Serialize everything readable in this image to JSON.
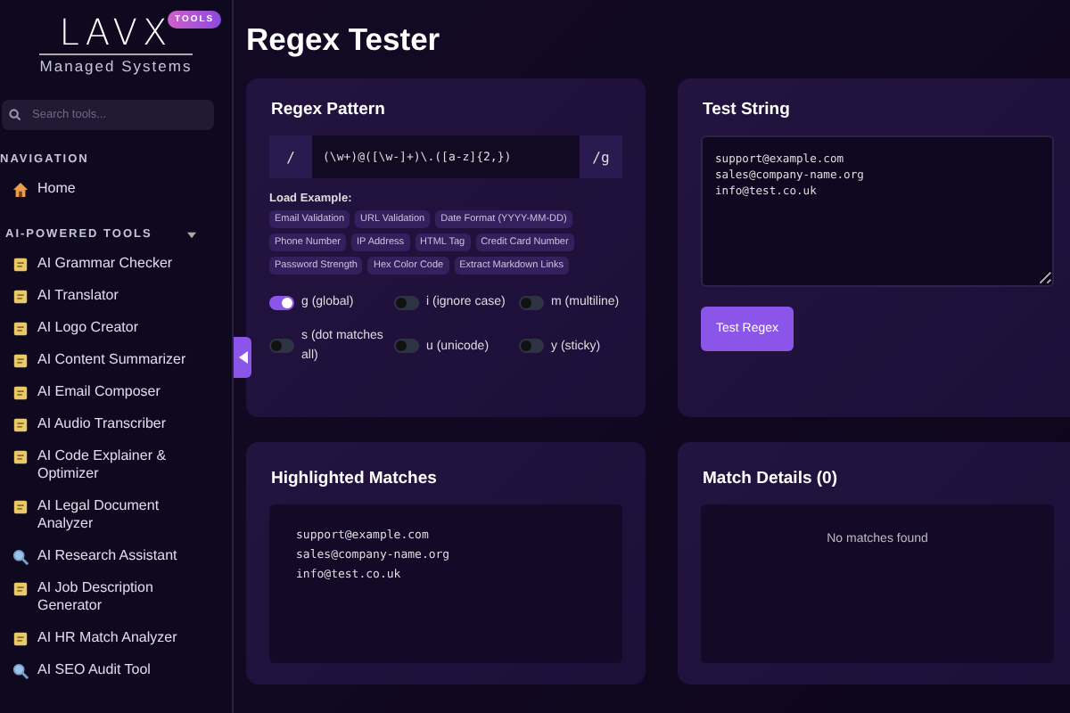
{
  "sidebar": {
    "logo": "LAVX",
    "logo_badge": "TOOLS",
    "tagline": "Managed Systems",
    "search": {
      "placeholder": "Search tools..."
    },
    "sections": [
      {
        "title": "NAVIGATION",
        "items": [
          {
            "label": "Home",
            "kind": "home"
          }
        ]
      },
      {
        "title": "AI-POWERED TOOLS",
        "expanded": true,
        "items": [
          {
            "label": "AI Grammar Checker",
            "kind": "tool"
          },
          {
            "label": "AI Translator",
            "kind": "tool"
          },
          {
            "label": "AI Logo Creator",
            "kind": "tool"
          },
          {
            "label": "AI Content Summarizer",
            "kind": "tool"
          },
          {
            "label": "AI Email Composer",
            "kind": "tool"
          },
          {
            "label": "AI Audio Transcriber",
            "kind": "tool"
          },
          {
            "label": "AI Code Explainer & Optimizer",
            "kind": "tool"
          },
          {
            "label": "AI Legal Document Analyzer",
            "kind": "tool"
          },
          {
            "label": "AI Research Assistant",
            "kind": "search"
          },
          {
            "label": "AI Job Description Generator",
            "kind": "tool"
          },
          {
            "label": "AI HR Match Analyzer",
            "kind": "tool"
          },
          {
            "label": "AI SEO Audit Tool",
            "kind": "search"
          }
        ]
      }
    ]
  },
  "page_title": "Regex Tester",
  "pattern_card": {
    "title": "Regex Pattern",
    "prefix": "/",
    "value": "(\\w+)@([\\w-]+)\\.([a-z]{2,})",
    "suffix": "/g",
    "examples_label": "Load Example:",
    "examples": [
      "Email Validation",
      "URL Validation",
      "Date Format (YYYY-MM-DD)",
      "Phone Number",
      "IP Address",
      "HTML Tag",
      "Credit Card Number",
      "Password Strength",
      "Hex Color Code",
      "Extract Markdown Links"
    ],
    "flags": [
      {
        "label": "g (global)",
        "on": true
      },
      {
        "label": "i (ignore case)",
        "on": false
      },
      {
        "label": "m (multiline)",
        "on": false
      },
      {
        "label": "s (dot matches all)",
        "on": false
      },
      {
        "label": "u (unicode)",
        "on": false
      },
      {
        "label": "y (sticky)",
        "on": false
      }
    ]
  },
  "test_card": {
    "title": "Test String",
    "value": "support@example.com\nsales@company-name.org\ninfo@test.co.uk",
    "button": "Test Regex"
  },
  "matches_card": {
    "title": "Highlighted Matches",
    "lines": [
      "support@example.com",
      "sales@company-name.org",
      "info@test.co.uk"
    ]
  },
  "details_card": {
    "title": "Match Details (0)",
    "empty": "No matches found"
  }
}
